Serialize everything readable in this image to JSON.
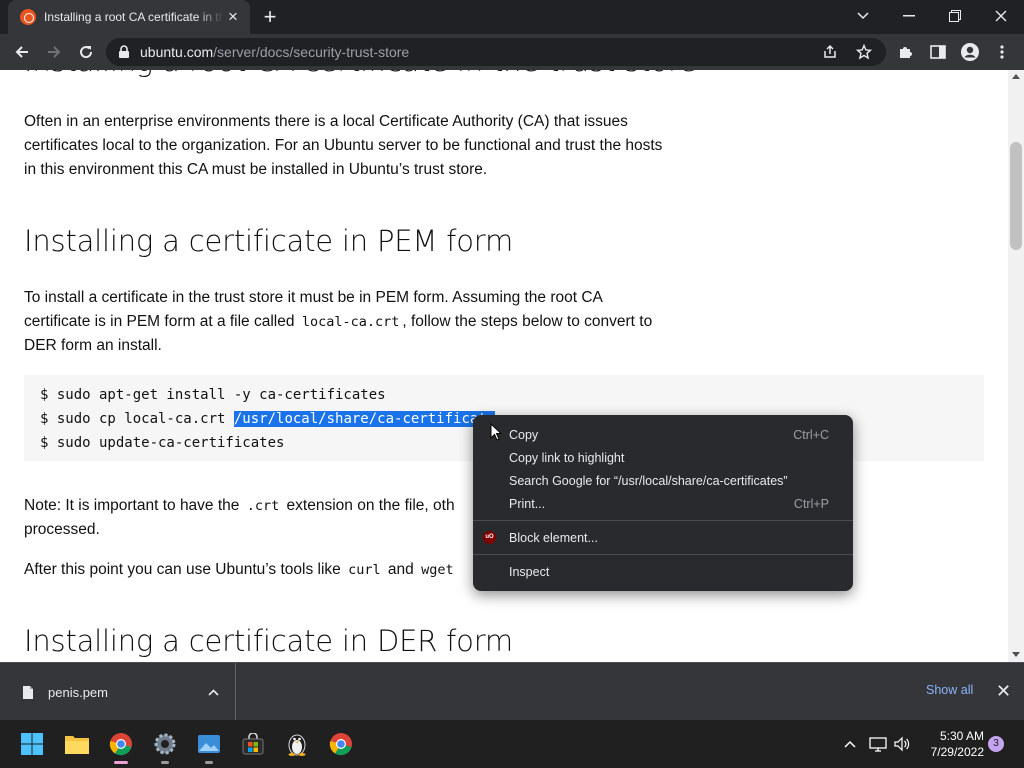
{
  "browser": {
    "tab_title": "Installing a root CA certificate in the trust store",
    "url_host": "ubuntu.com",
    "url_path": "/server/docs/security-trust-store"
  },
  "page": {
    "partial_heading": "Installing a root CA certificate in the trust store",
    "intro": "Often in an enterprise environments there is a local Certificate Authority (CA) that issues certificates local to the organization. For an Ubuntu server to be functional and trust the hosts in this environment this CA must be installed in Ubuntu’s trust store.",
    "h2_pem": "Installing a certificate in PEM form",
    "pem_para_1": "To install a certificate in the trust store it must be in PEM form. Assuming the root CA certificate is in PEM form at a file called",
    "pem_code": "local-ca.crt",
    "pem_para_2": ", follow the steps below to convert to DER form an install.",
    "code_line_1": "$ sudo apt-get install -y ca-certificates",
    "code_line_2_prefix": "$ sudo cp local-ca.crt ",
    "code_line_2_selected": "/usr/local/share/ca-certificate",
    "code_line_3": "$ sudo update-ca-certificates",
    "note_label": "Note:",
    "note_text_1": " It is important to have the ",
    "note_code": ".crt",
    "note_text_2": " extension on the file, oth",
    "note_text_3": "processed.",
    "after_1": "After this point you can use Ubuntu’s tools like ",
    "after_code_1": "curl",
    "after_and": " and ",
    "after_code_2": "wget",
    "h2_der": "Installing a certificate in DER form"
  },
  "context_menu": {
    "items": [
      {
        "label": "Copy",
        "shortcut": "Ctrl+C"
      },
      {
        "label": "Copy link to highlight",
        "shortcut": ""
      },
      {
        "label": "Search Google for “/usr/local/share/ca-certificates”",
        "shortcut": ""
      },
      {
        "label": "Print...",
        "shortcut": "Ctrl+P"
      },
      {
        "label": "Block element...",
        "shortcut": ""
      },
      {
        "label": "Inspect",
        "shortcut": ""
      }
    ],
    "ublock_icon_text": "uO"
  },
  "downloads": {
    "file_name": "penis.pem",
    "show_all": "Show all"
  },
  "taskbar": {
    "time": "5:30 AM",
    "date": "7/29/2022",
    "notification_count": "3"
  },
  "colors": {
    "selection": "#1a73e8",
    "ubuntu_orange": "#e95420",
    "link_blue": "#8ab4f8"
  }
}
